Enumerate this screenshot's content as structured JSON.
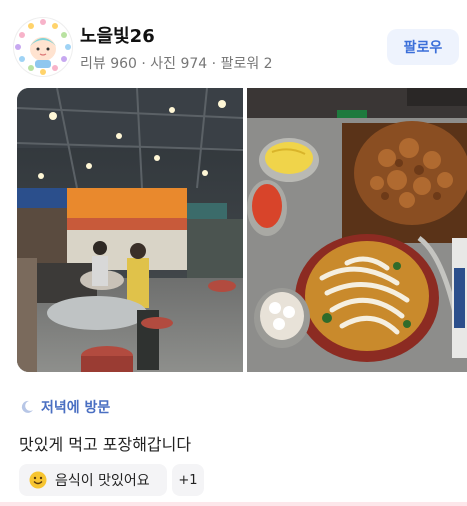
{
  "header": {
    "name": "노을빛26",
    "stats": "리뷰 960 · 사진 974 · 팔로워 2",
    "follow_label": "팔로우"
  },
  "visit": {
    "label": "저녁에 방문",
    "icon": "moon-icon"
  },
  "review": {
    "text": "맛있게 먹고 포장해갑니다"
  },
  "tags": {
    "primary": "음식이 맛있어요",
    "more": "+1"
  },
  "colors": {
    "accent": "#3b6fd9",
    "visit_text": "#4a6fc2",
    "tag_bg": "#f4f4f6"
  }
}
